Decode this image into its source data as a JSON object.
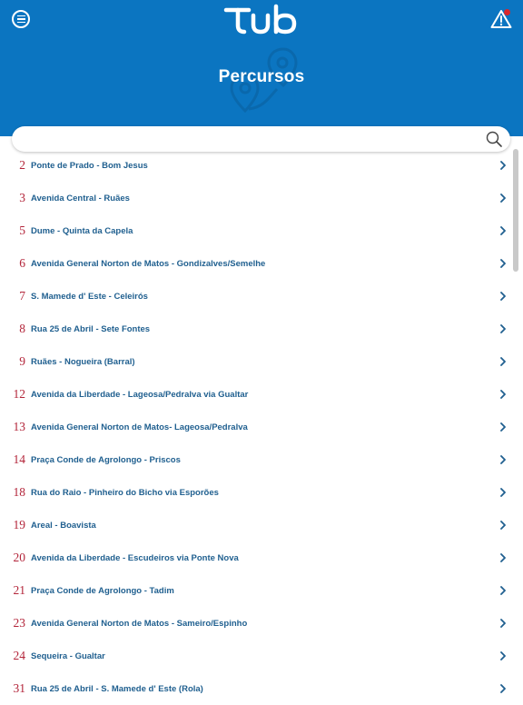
{
  "header": {
    "title": "Percursos",
    "brand_color": "#0b75c1",
    "accent_color": "#b3253a",
    "menu_icon": "menu-icon",
    "alert_icon": "warning-icon",
    "logo": "tub-logo"
  },
  "search": {
    "value": "",
    "placeholder": "",
    "icon": "search-icon"
  },
  "routes": [
    {
      "number": "2",
      "name": "Ponte de Prado - Bom Jesus"
    },
    {
      "number": "3",
      "name": "Avenida Central - Ruães"
    },
    {
      "number": "5",
      "name": "Dume - Quinta da Capela"
    },
    {
      "number": "6",
      "name": "Avenida General Norton de Matos - Gondizalves/Semelhe"
    },
    {
      "number": "7",
      "name": "S. Mamede d' Este - Celeirós"
    },
    {
      "number": "8",
      "name": "Rua 25 de Abril - Sete Fontes"
    },
    {
      "number": "9",
      "name": "Ruães - Nogueira (Barral)"
    },
    {
      "number": "12",
      "name": "Avenida da Liberdade - Lageosa/Pedralva via Gualtar"
    },
    {
      "number": "13",
      "name": "Avenida General Norton de Matos- Lageosa/Pedralva"
    },
    {
      "number": "14",
      "name": "Praça Conde de Agrolongo - Priscos"
    },
    {
      "number": "18",
      "name": "Rua do Raio - Pinheiro do Bicho via Esporões"
    },
    {
      "number": "19",
      "name": "Areal - Boavista"
    },
    {
      "number": "20",
      "name": "Avenida da Liberdade - Escudeiros via Ponte Nova"
    },
    {
      "number": "21",
      "name": "Praça Conde de Agrolongo - Tadim"
    },
    {
      "number": "23",
      "name": "Avenida General Norton de Matos - Sameiro/Espinho"
    },
    {
      "number": "24",
      "name": "Sequeira - Gualtar"
    },
    {
      "number": "31",
      "name": "Rua 25 de Abril - S. Mamede d' Este (Rola)"
    }
  ]
}
